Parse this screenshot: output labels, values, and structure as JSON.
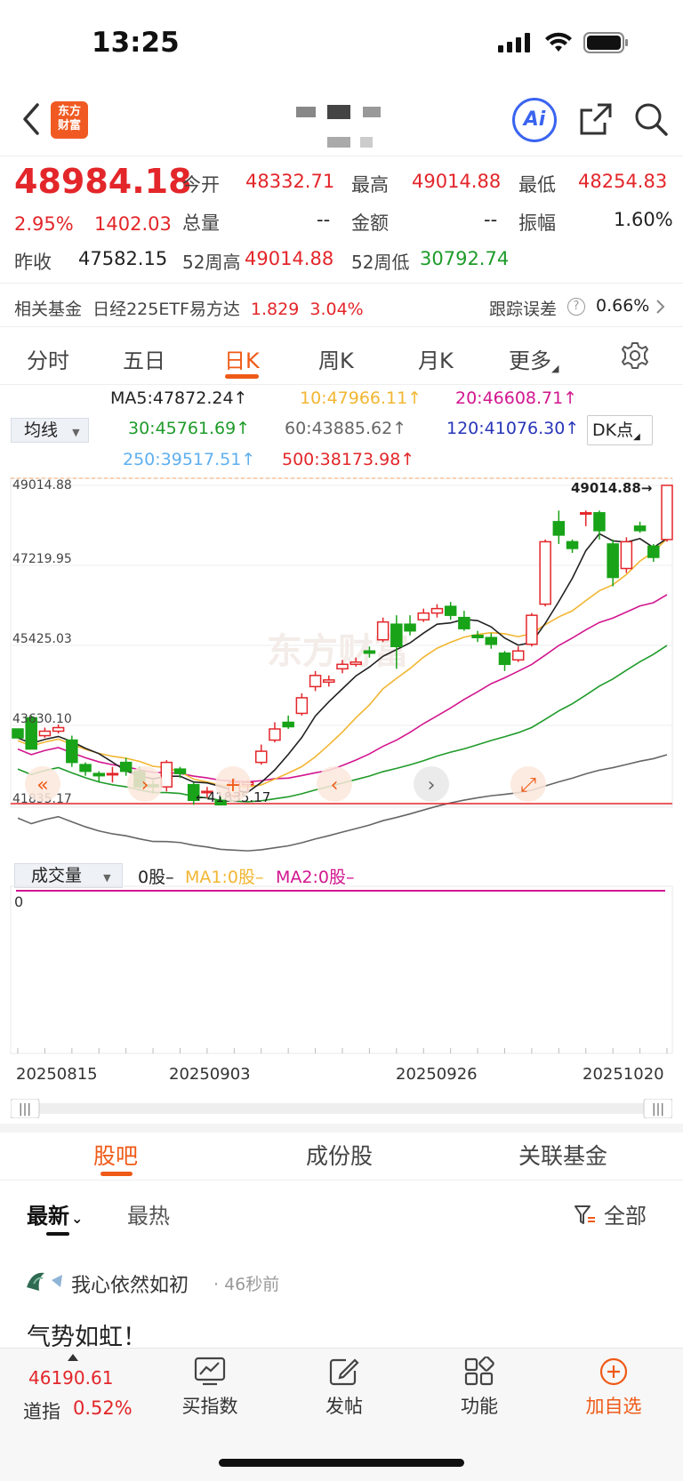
{
  "status_bar": {
    "time": "13:25"
  },
  "header": {
    "logo_text_1": "东方",
    "logo_text_2": "财富",
    "ai_label": "Ai"
  },
  "quote": {
    "price": "48984.18",
    "change_pct": "2.95%",
    "change_abs": "1402.03",
    "prev_close_label": "昨收",
    "prev_close": "47582.15",
    "open_label": "今开",
    "open": "48332.71",
    "high_label": "最高",
    "high": "49014.88",
    "low_label": "最低",
    "low": "48254.83",
    "volume_label": "总量",
    "volume": "--",
    "amount_label": "金额",
    "amount": "--",
    "amplitude_label": "振幅",
    "amplitude": "1.60%",
    "week52_high_label": "52周高",
    "week52_high": "49014.88",
    "week52_low_label": "52周低",
    "week52_low": "30792.74"
  },
  "fund_row": {
    "label": "相关基金",
    "fund_name": "日经225ETF易方达",
    "fund_price": "1.829",
    "fund_pct": "3.04%",
    "tracking_label": "跟踪误差",
    "tracking_help": "?",
    "tracking_value": "0.66%"
  },
  "period_tabs": [
    "分时",
    "五日",
    "日K",
    "周K",
    "月K",
    "更多"
  ],
  "active_period": "日K",
  "ma_legend": {
    "select_label": "均线",
    "dk_label": "DK点",
    "items": [
      {
        "text": "MA5:47872.24↑",
        "color": "#222222"
      },
      {
        "text": "10:47966.11↑",
        "color": "#f2b632"
      },
      {
        "text": "20:46608.71↑",
        "color": "#d2168f"
      },
      {
        "text": "30:45761.69↑",
        "color": "#1f9b2a"
      },
      {
        "text": "60:43885.62↑",
        "color": "#666666"
      },
      {
        "text": "120:41076.30↑",
        "color": "#2836b8"
      },
      {
        "text": "250:39517.51↑",
        "color": "#5fb0f0"
      },
      {
        "text": "500:38173.98↑",
        "color": "#e3262a"
      }
    ]
  },
  "chart_data": {
    "type": "candlestick",
    "y_ticks": [
      "49014.88",
      "47219.95",
      "45425.03",
      "43630.10",
      "41835.17"
    ],
    "ylim": [
      41835.17,
      49014.88
    ],
    "max_marker": "49014.88",
    "min_marker": "41835.17",
    "x_date_labels": [
      "20250815",
      "20250903",
      "20250926",
      "20251020"
    ],
    "candles": [
      [
        43550,
        43350,
        43350,
        43550
      ],
      [
        43800,
        43100,
        43100,
        43850
      ],
      [
        43400,
        43500,
        43350,
        43580
      ],
      [
        43500,
        43580,
        43450,
        43650
      ],
      [
        43300,
        42800,
        42700,
        43400
      ],
      [
        42750,
        42600,
        42500,
        42800
      ],
      [
        42550,
        42500,
        42350,
        42600
      ],
      [
        42550,
        42550,
        42350,
        42700
      ],
      [
        42800,
        42600,
        42500,
        42900
      ],
      [
        42600,
        42250,
        42200,
        42700
      ],
      [
        42300,
        42250,
        42100,
        42400
      ],
      [
        42250,
        42800,
        42150,
        42850
      ],
      [
        42650,
        42550,
        42450,
        42700
      ],
      [
        42300,
        41950,
        41850,
        42350
      ],
      [
        42150,
        42150,
        42000,
        42250
      ],
      [
        41950,
        41850,
        41835,
        42050
      ],
      [
        42050,
        42350,
        42000,
        42450
      ],
      [
        42300,
        42350,
        42150,
        42400
      ],
      [
        42800,
        43050,
        42750,
        43200
      ],
      [
        43300,
        43550,
        43250,
        43700
      ],
      [
        43700,
        43600,
        43550,
        43850
      ],
      [
        43900,
        44250,
        43850,
        44350
      ],
      [
        44500,
        44750,
        44400,
        44850
      ],
      [
        44600,
        44650,
        44500,
        44750
      ],
      [
        44900,
        45000,
        44800,
        45100
      ],
      [
        45000,
        45050,
        44950,
        45150
      ],
      [
        45300,
        45250,
        45150,
        45400
      ],
      [
        45550,
        45950,
        45500,
        46050
      ],
      [
        45900,
        45400,
        44900,
        46100
      ],
      [
        45900,
        45750,
        45650,
        46100
      ],
      [
        46000,
        46150,
        45950,
        46250
      ],
      [
        46150,
        46250,
        46050,
        46350
      ],
      [
        46300,
        46100,
        46000,
        46400
      ],
      [
        46050,
        45800,
        45750,
        46200
      ],
      [
        45650,
        45600,
        45500,
        45750
      ],
      [
        45600,
        45450,
        45350,
        45700
      ],
      [
        45250,
        45000,
        44850,
        45300
      ],
      [
        45100,
        45300,
        45050,
        45400
      ],
      [
        45450,
        46100,
        45400,
        46150
      ],
      [
        46350,
        47750,
        46300,
        47800
      ],
      [
        48200,
        47900,
        47700,
        48450
      ],
      [
        47750,
        47600,
        47500,
        47800
      ],
      [
        48400,
        48400,
        48100,
        48450
      ],
      [
        48400,
        48000,
        47800,
        48450
      ],
      [
        47700,
        46950,
        46750,
        47800
      ],
      [
        47150,
        47750,
        47050,
        47850
      ],
      [
        48100,
        48000,
        47950,
        48200
      ],
      [
        47650,
        47400,
        47300,
        47700
      ],
      [
        47800,
        49015,
        47750,
        49015
      ]
    ],
    "ma_lines": [
      "MA5",
      "10",
      "20",
      "30",
      "60",
      "500"
    ]
  },
  "volume": {
    "select_label": "成交量",
    "value": "0股",
    "ma1": "MA1:0股",
    "ma2": "MA2:0股",
    "y_label": "0"
  },
  "section_tabs": [
    "股吧",
    "成份股",
    "关联基金"
  ],
  "active_section": "股吧",
  "sort": {
    "newest": "最新",
    "hottest": "最热",
    "filter_label": "全部"
  },
  "post": {
    "user": "我心依然如初",
    "time": "46秒前",
    "content": "气势如虹！"
  },
  "bottom_bar": {
    "index_value": "46190.61",
    "index_name": "道指",
    "index_pct": "0.52%",
    "nav": [
      {
        "label": "买指数",
        "icon": "chart-icon"
      },
      {
        "label": "发帖",
        "icon": "edit-icon"
      },
      {
        "label": "功能",
        "icon": "grid-icon"
      },
      {
        "label": "加自选",
        "icon": "add-circle-icon"
      }
    ]
  },
  "watermark": "东方财富"
}
